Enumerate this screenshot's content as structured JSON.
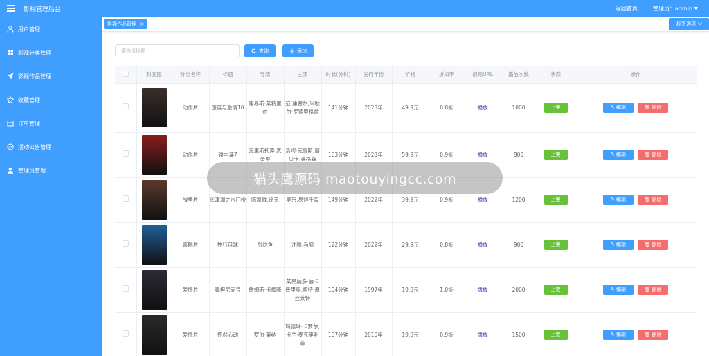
{
  "header": {
    "title": "影视管理后台",
    "home_link": "返回首页",
    "admin_label": "管理员：admin"
  },
  "sidebar": {
    "items": [
      {
        "label": "用户管理",
        "icon": "user-icon"
      },
      {
        "label": "影视分类管理",
        "icon": "grid-icon"
      },
      {
        "label": "影视作品管理",
        "icon": "send-icon"
      },
      {
        "label": "收藏管理",
        "icon": "star-icon"
      },
      {
        "label": "订单管理",
        "icon": "order-icon"
      },
      {
        "label": "活动公告管理",
        "icon": "chat-icon"
      },
      {
        "label": "管理员管理",
        "icon": "person-icon"
      }
    ]
  },
  "tags": {
    "active_tag": "影视作品管理",
    "close": "×",
    "options_label": "标签选项"
  },
  "toolbar": {
    "search_placeholder": "请选择标题",
    "query_label": "查询",
    "add_label": "添加"
  },
  "table": {
    "columns": [
      "封面图",
      "分类名称",
      "标题",
      "导演",
      "主演",
      "时长(分钟)",
      "发行年份",
      "价格",
      "折扣率",
      "视频URL",
      "播放次数",
      "状态",
      "操作"
    ],
    "rows": [
      {
        "category": "动作片",
        "title": "速度与激情10",
        "director": "路易斯·莱特里尔",
        "cast": "范·迪塞尔,米歇尔·罗德里格兹",
        "duration": "141分钟",
        "year": "2023年",
        "price": "49.9元",
        "discount": "0.8折",
        "url": "播放",
        "plays": "1000",
        "status": "上架",
        "edit": "编辑",
        "delete": "删除",
        "poster": "#3a2f2a"
      },
      {
        "category": "动作片",
        "title": "碟中谍7",
        "director": "克里斯托弗·麦奎里",
        "cast": "汤姆·克鲁斯,丽贝卡·弗格森",
        "duration": "163分钟",
        "year": "2023年",
        "price": "59.9元",
        "discount": "0.9折",
        "url": "播放",
        "plays": "800",
        "status": "上架",
        "edit": "编辑",
        "delete": "删除",
        "poster": "#8a1c1c"
      },
      {
        "category": "战争片",
        "title": "长津湖之水门桥",
        "director": "陈凯歌,徐克",
        "cast": "吴京,易烊千玺",
        "duration": "149分钟",
        "year": "2022年",
        "price": "39.9元",
        "discount": "0.9折",
        "url": "播放",
        "plays": "1200",
        "status": "上架",
        "edit": "编辑",
        "delete": "删除",
        "poster": "#5a3a2a"
      },
      {
        "category": "喜剧片",
        "title": "独行月球",
        "director": "张吃鱼",
        "cast": "沈腾,马丽",
        "duration": "122分钟",
        "year": "2022年",
        "price": "29.9元",
        "discount": "0.8折",
        "url": "播放",
        "plays": "900",
        "status": "上架",
        "edit": "编辑",
        "delete": "删除",
        "poster": "#1f5f9a"
      },
      {
        "category": "爱情片",
        "title": "泰坦尼克号",
        "director": "詹姆斯·卡梅隆",
        "cast": "莱昂纳多·迪卡普里奥,凯特·温丝莱特",
        "duration": "194分钟",
        "year": "1997年",
        "price": "19.9元",
        "discount": "1.0折",
        "url": "播放",
        "plays": "2000",
        "status": "上架",
        "edit": "编辑",
        "delete": "删除",
        "poster": "#2c2a36"
      },
      {
        "category": "爱情片",
        "title": "怦然心动",
        "director": "罗伯·莱纳",
        "cast": "玛德琳·卡罗尔,卡兰·麦克奥利菲",
        "duration": "107分钟",
        "year": "2010年",
        "price": "19.9元",
        "discount": "0.9折",
        "url": "播放",
        "plays": "1500",
        "status": "上架",
        "edit": "编辑",
        "delete": "删除",
        "poster": "#2a2a2a"
      }
    ]
  },
  "watermark": "猫头鹰源码 maotouyingcc.com",
  "colors": {
    "primary": "#409eff",
    "success": "#67c23a",
    "danger": "#f56c6c"
  }
}
